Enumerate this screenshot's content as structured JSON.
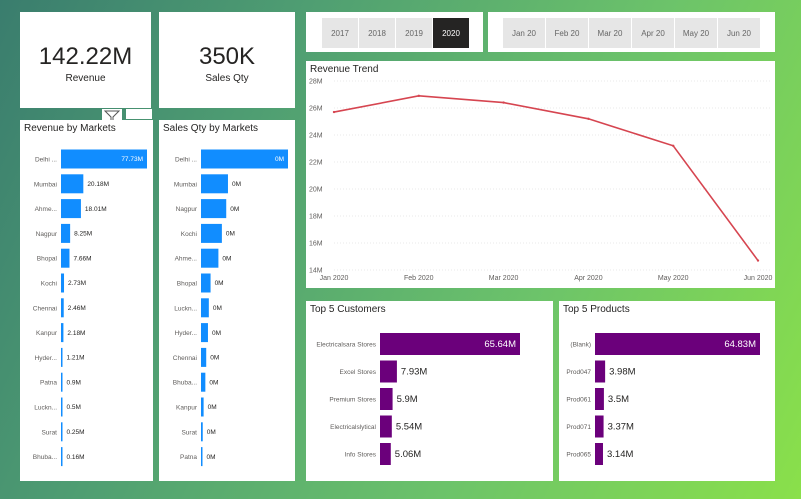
{
  "kpis": {
    "revenue": {
      "value": "142.22M",
      "label": "Revenue"
    },
    "sales_qty": {
      "value": "350K",
      "label": "Sales Qty"
    }
  },
  "year_slicer": {
    "options": [
      "2017",
      "2018",
      "2019",
      "2020"
    ],
    "selected": "2020"
  },
  "month_slicer": {
    "options": [
      "Jan 20",
      "Feb 20",
      "Mar 20",
      "Apr 20",
      "May 20",
      "Jun 20"
    ]
  },
  "colors": {
    "bar_blue": "#118dff",
    "bar_purple": "#6b007b",
    "line_red": "#d64550",
    "selected_dark": "#252423"
  },
  "chart_data": [
    {
      "id": "revenue_by_markets",
      "type": "bar",
      "orientation": "horizontal",
      "title": "Revenue by Markets",
      "categories": [
        "Delhi ...",
        "Mumbai",
        "Ahme...",
        "Nagpur",
        "Bhopal",
        "Kochi",
        "Chennai",
        "Kanpur",
        "Hyder...",
        "Patna",
        "Luckn...",
        "Surat",
        "Bhuba..."
      ],
      "values": [
        77.73,
        20.18,
        18.01,
        8.25,
        7.66,
        2.73,
        2.46,
        2.18,
        1.21,
        0.9,
        0.5,
        0.25,
        0.16
      ],
      "labels": [
        "77.73M",
        "20.18M",
        "18.01M",
        "8.25M",
        "7.66M",
        "2.73M",
        "2.46M",
        "2.18M",
        "1.21M",
        "0.9M",
        "0.5M",
        "0.25M",
        "0.16M"
      ],
      "xlim": [
        0,
        77.73
      ]
    },
    {
      "id": "sales_qty_by_markets",
      "type": "bar",
      "orientation": "horizontal",
      "title": "Sales Qty by Markets",
      "categories": [
        "Delhi ...",
        "Mumbai",
        "Nagpur",
        "Kochi",
        "Ahme...",
        "Bhopal",
        "Luckn...",
        "Hyder...",
        "Chennai",
        "Bhuba...",
        "Kanpur",
        "Surat",
        "Patna"
      ],
      "values": [
        1.0,
        0.31,
        0.29,
        0.24,
        0.2,
        0.11,
        0.09,
        0.08,
        0.06,
        0.05,
        0.03,
        0.02,
        0.01
      ],
      "labels": [
        "0M",
        "0M",
        "0M",
        "0M",
        "0M",
        "0M",
        "0M",
        "0M",
        "0M",
        "0M",
        "0M",
        "0M",
        "0M"
      ],
      "xlim": [
        0,
        1
      ]
    },
    {
      "id": "revenue_trend",
      "type": "line",
      "title": "Revenue Trend",
      "x": [
        "Jan 2020",
        "Feb 2020",
        "Mar 2020",
        "Apr 2020",
        "May 2020",
        "Jun 2020"
      ],
      "values": [
        25.7,
        26.9,
        26.4,
        25.2,
        23.2,
        14.7
      ],
      "ylim": [
        14,
        28
      ],
      "yticks": [
        14,
        16,
        18,
        20,
        22,
        24,
        26,
        28
      ],
      "ytick_labels": [
        "14M",
        "16M",
        "18M",
        "20M",
        "22M",
        "24M",
        "26M",
        "28M"
      ],
      "grid": true
    },
    {
      "id": "top5_customers",
      "type": "bar",
      "orientation": "horizontal",
      "title": "Top 5 Customers",
      "categories": [
        "Electricalsara Stores",
        "Excel Stores",
        "Premium Stores",
        "Electricalslytical",
        "Info Stores"
      ],
      "values": [
        65.64,
        7.93,
        5.9,
        5.54,
        5.06
      ],
      "labels": [
        "65.64M",
        "7.93M",
        "5.9M",
        "5.54M",
        "5.06M"
      ],
      "xlim": [
        0,
        65.64
      ]
    },
    {
      "id": "top5_products",
      "type": "bar",
      "orientation": "horizontal",
      "title": "Top 5 Products",
      "categories": [
        "(Blank)",
        "Prod047",
        "Prod061",
        "Prod071",
        "Prod065"
      ],
      "values": [
        64.83,
        3.98,
        3.5,
        3.37,
        3.14
      ],
      "labels": [
        "64.83M",
        "3.98M",
        "3.5M",
        "3.37M",
        "3.14M"
      ],
      "xlim": [
        0,
        64.83
      ]
    }
  ]
}
